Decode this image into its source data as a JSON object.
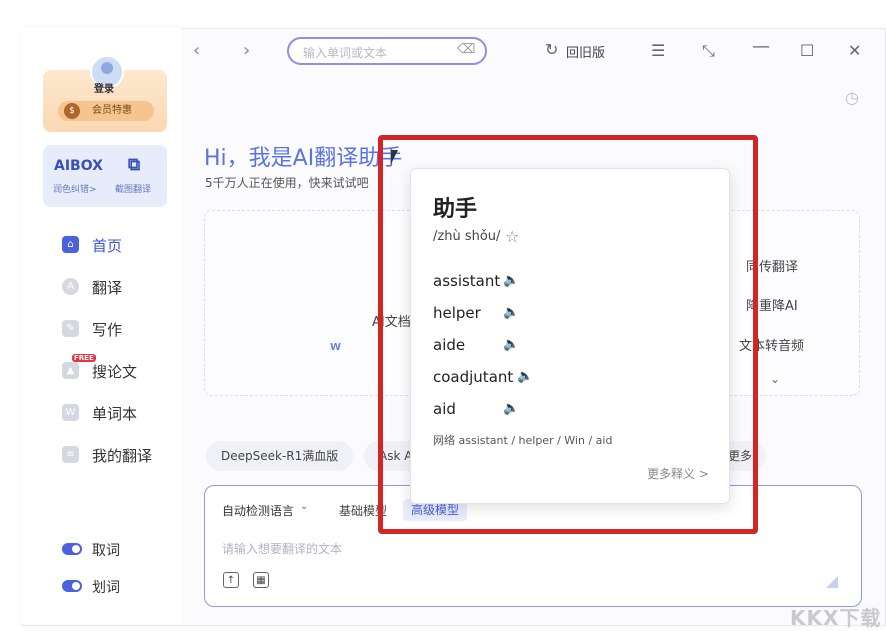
{
  "header": {
    "search_placeholder": "输入单词或文本",
    "old_version": "回旧版"
  },
  "sidebar": {
    "login": "登录",
    "vip": "会员特惠",
    "tools": [
      {
        "big": "AIBOX",
        "small": "润色纠错>"
      },
      {
        "big": "⧉",
        "small": "截图翻译"
      }
    ],
    "items": [
      {
        "label": "首页",
        "active": true
      },
      {
        "label": "翻译"
      },
      {
        "label": "写作"
      },
      {
        "label": "搜论文",
        "tag": "FREE"
      },
      {
        "label": "单词本"
      },
      {
        "label": "我的翻译"
      }
    ],
    "toggles": [
      {
        "label": "取词"
      },
      {
        "label": "划词"
      }
    ]
  },
  "main": {
    "greeting": "Hi，我是AI翻译助手",
    "subtitle": "5千万人正在使用，快来试试吧",
    "features": {
      "center": "AI文档",
      "right": [
        "同传翻译",
        "降重降AI",
        "文本转音频"
      ]
    },
    "chips": [
      "DeepSeek-R1满血版",
      "Ask A",
      "更多"
    ],
    "input": {
      "lang": "自动检测语言",
      "model_basic": "基础模型",
      "model_advanced": "高级模型",
      "placeholder": "请输入想要翻译的文本"
    }
  },
  "popup": {
    "word": "助手",
    "pronunciation": "/zhù shǒu/",
    "senses": [
      "assistant",
      "helper",
      "aide",
      "coadjutant",
      "aid"
    ],
    "web": "网络 assistant / helper / Win / aid",
    "more": "更多释义 >"
  },
  "watermark": "KKX下载"
}
